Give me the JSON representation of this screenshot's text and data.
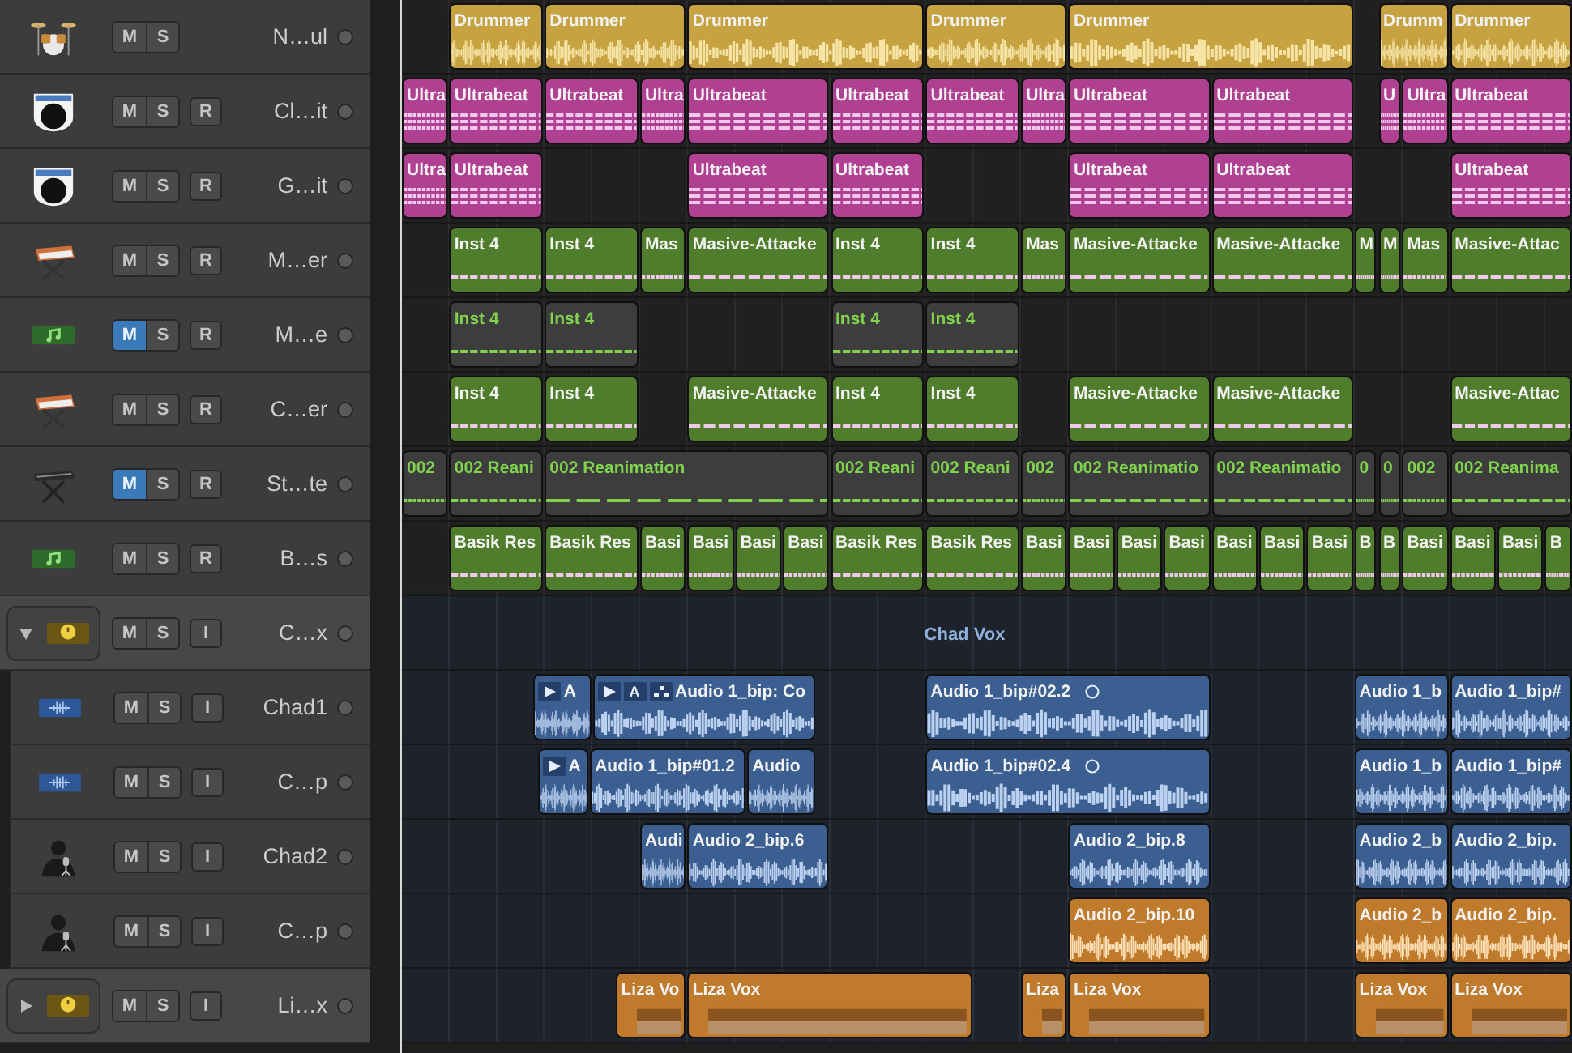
{
  "tracks": [
    {
      "name": "N…ul",
      "kind": "drummer",
      "color": "#c7a240",
      "buttons": [
        {
          "label": "M",
          "kind": "mute",
          "on": false
        },
        {
          "label": "S",
          "kind": "solo",
          "on": false
        }
      ],
      "regions": [
        {
          "name": "Drummer"
        },
        {
          "name": "Drummer"
        },
        {
          "name": "Drummer"
        },
        {
          "name": "Drummer"
        },
        {
          "name": "Drummer"
        },
        {
          "name": "Drumm"
        },
        {
          "name": "Drummer"
        }
      ]
    },
    {
      "name": "Cl…it",
      "kind": "drum-machine",
      "color": "#b04192",
      "buttons": [
        {
          "label": "M",
          "kind": "mute",
          "on": false
        },
        {
          "label": "S",
          "kind": "solo",
          "on": false
        },
        {
          "label": "R",
          "kind": "record",
          "on": false
        }
      ],
      "regions": [
        {
          "name": "Ultra"
        },
        {
          "name": "Ultrabeat"
        },
        {
          "name": "Ultrabeat"
        },
        {
          "name": "Ultra"
        },
        {
          "name": "Ultrabeat"
        },
        {
          "name": "Ultrabeat"
        },
        {
          "name": "Ultrabeat"
        },
        {
          "name": "Ultra"
        },
        {
          "name": "Ultrabeat"
        },
        {
          "name": "Ultrabeat"
        },
        {
          "name": "U"
        },
        {
          "name": "Ultra"
        },
        {
          "name": "Ultrabeat"
        }
      ]
    },
    {
      "name": "G…it",
      "kind": "drum-machine",
      "color": "#b04192",
      "buttons": [
        {
          "label": "M",
          "kind": "mute",
          "on": false
        },
        {
          "label": "S",
          "kind": "solo",
          "on": false
        },
        {
          "label": "R",
          "kind": "record",
          "on": false
        }
      ],
      "regions": [
        {
          "name": "Ultra"
        },
        {
          "name": "Ultrabeat"
        },
        {
          "name": "Ultrabeat"
        },
        {
          "name": "Ultrabeat"
        },
        {
          "name": "Ultrabeat"
        },
        {
          "name": "Ultrabeat"
        },
        {
          "name": "Ultrabeat"
        }
      ]
    },
    {
      "name": "M…er",
      "kind": "synth",
      "color": "#507d2b",
      "buttons": [
        {
          "label": "M",
          "kind": "mute",
          "on": false
        },
        {
          "label": "S",
          "kind": "solo",
          "on": false
        },
        {
          "label": "R",
          "kind": "record",
          "on": false
        }
      ],
      "regions": [
        {
          "name": "Inst 4"
        },
        {
          "name": "Inst 4"
        },
        {
          "name": "Mas"
        },
        {
          "name": "Masive-Attacke"
        },
        {
          "name": "Inst 4"
        },
        {
          "name": "Inst 4"
        },
        {
          "name": "Mas"
        },
        {
          "name": "Masive-Attacke"
        },
        {
          "name": "Masive-Attacke"
        },
        {
          "name": "M"
        },
        {
          "name": "M"
        },
        {
          "name": "Mas"
        },
        {
          "name": "Masive-Attac"
        }
      ]
    },
    {
      "name": "M…e",
      "kind": "midi",
      "color": "#7fd14e",
      "buttons": [
        {
          "label": "M",
          "kind": "mute",
          "on": true
        },
        {
          "label": "S",
          "kind": "solo",
          "on": false
        },
        {
          "label": "R",
          "kind": "record",
          "on": false
        }
      ],
      "regions": [
        {
          "name": "Inst 4"
        },
        {
          "name": "Inst 4"
        },
        {
          "name": "Inst 4"
        },
        {
          "name": "Inst 4"
        }
      ]
    },
    {
      "name": "C…er",
      "kind": "synth",
      "color": "#507d2b",
      "buttons": [
        {
          "label": "M",
          "kind": "mute",
          "on": false
        },
        {
          "label": "S",
          "kind": "solo",
          "on": false
        },
        {
          "label": "R",
          "kind": "record",
          "on": false
        }
      ],
      "regions": [
        {
          "name": "Inst 4"
        },
        {
          "name": "Inst 4"
        },
        {
          "name": "Masive-Attacke"
        },
        {
          "name": "Inst 4"
        },
        {
          "name": "Inst 4"
        },
        {
          "name": "Masive-Attacke"
        },
        {
          "name": "Masive-Attacke"
        },
        {
          "name": "Masive-Attac"
        }
      ]
    },
    {
      "name": "St…te",
      "kind": "keyboard",
      "color": "#7fd14e",
      "buttons": [
        {
          "label": "M",
          "kind": "mute",
          "on": true
        },
        {
          "label": "S",
          "kind": "solo",
          "on": false
        },
        {
          "label": "R",
          "kind": "record",
          "on": false
        }
      ],
      "regions": [
        {
          "name": "002"
        },
        {
          "name": "002 Reani"
        },
        {
          "name": "002 Reanimation"
        },
        {
          "name": "002 Reani"
        },
        {
          "name": "002 Reani"
        },
        {
          "name": "002"
        },
        {
          "name": "002 Reanimatio"
        },
        {
          "name": "002 Reanimatio"
        },
        {
          "name": "0"
        },
        {
          "name": "0"
        },
        {
          "name": "002"
        },
        {
          "name": "002 Reanima"
        }
      ]
    },
    {
      "name": "B…s",
      "kind": "midi",
      "color": "#507d2b",
      "buttons": [
        {
          "label": "M",
          "kind": "mute",
          "on": false
        },
        {
          "label": "S",
          "kind": "solo",
          "on": false
        },
        {
          "label": "R",
          "kind": "record",
          "on": false
        }
      ],
      "regions": [
        {
          "name": "Basik Res"
        },
        {
          "name": "Basik Res"
        },
        {
          "name": "Basi"
        },
        {
          "name": "Basi"
        },
        {
          "name": "Basi"
        },
        {
          "name": "Basi"
        },
        {
          "name": "Basik Res"
        },
        {
          "name": "Basik Res"
        },
        {
          "name": "Basi"
        },
        {
          "name": "Basi"
        },
        {
          "name": "Basi"
        },
        {
          "name": "Basi"
        },
        {
          "name": "Basi"
        },
        {
          "name": "Basi"
        },
        {
          "name": "Basi"
        },
        {
          "name": "B"
        },
        {
          "name": "B"
        },
        {
          "name": "Basi"
        },
        {
          "name": "Basi"
        },
        {
          "name": "Basi"
        },
        {
          "name": "B"
        }
      ]
    },
    {
      "name": "C…x",
      "kind": "folder",
      "expanded": true,
      "lane_label": "Chad Vox",
      "buttons": [
        {
          "label": "M",
          "kind": "mute",
          "on": false
        },
        {
          "label": "S",
          "kind": "solo",
          "on": false
        },
        {
          "label": "I",
          "kind": "input",
          "on": false
        }
      ],
      "children": [
        {
          "name": "Chad1",
          "kind": "audio",
          "color": "#3b5f90",
          "buttons": [
            {
              "label": "M",
              "kind": "mute",
              "on": false
            },
            {
              "label": "S",
              "kind": "solo",
              "on": false
            },
            {
              "label": "I",
              "kind": "input",
              "on": false
            }
          ],
          "regions": [
            {
              "name": "A",
              "take": true,
              "comp": false,
              "circle": false
            },
            {
              "name": "Audio 1_bip: Co",
              "badge": "A",
              "take": true,
              "comp": true,
              "circle": false
            },
            {
              "name": "Audio 1_bip#02.2",
              "take": false,
              "comp": false,
              "circle": true
            },
            {
              "name": "Audio 1_b",
              "take": false,
              "comp": false,
              "circle": false
            },
            {
              "name": "Audio 1_bip#",
              "take": false,
              "comp": false,
              "circle": false
            }
          ]
        },
        {
          "name": "C…p",
          "kind": "audio",
          "color": "#3b5f90",
          "buttons": [
            {
              "label": "M",
              "kind": "mute",
              "on": false
            },
            {
              "label": "S",
              "kind": "solo",
              "on": false
            },
            {
              "label": "I",
              "kind": "input",
              "on": false
            }
          ],
          "regions": [
            {
              "name": "A",
              "take": true,
              "comp": false,
              "circle": false
            },
            {
              "name": "Audio 1_bip#01.2",
              "take": false,
              "comp": false,
              "circle": false
            },
            {
              "name": "Audio",
              "take": false,
              "comp": false,
              "circle": false
            },
            {
              "name": "Audio 1_bip#02.4",
              "take": false,
              "comp": false,
              "circle": true
            },
            {
              "name": "Audio 1_b",
              "take": false,
              "comp": false,
              "circle": false
            },
            {
              "name": "Audio 1_bip#",
              "take": false,
              "comp": false,
              "circle": false
            }
          ]
        },
        {
          "name": "Chad2",
          "kind": "vocal",
          "color": "#3b5f90",
          "buttons": [
            {
              "label": "M",
              "kind": "mute",
              "on": false
            },
            {
              "label": "S",
              "kind": "solo",
              "on": false
            },
            {
              "label": "I",
              "kind": "input",
              "on": false
            }
          ],
          "regions": [
            {
              "name": "Audi",
              "take": false,
              "comp": false,
              "circle": false
            },
            {
              "name": "Audio 2_bip.6",
              "take": false,
              "comp": false,
              "circle": false
            },
            {
              "name": "Audio 2_bip.8",
              "take": false,
              "comp": false,
              "circle": false
            },
            {
              "name": "Audio 2_b",
              "take": false,
              "comp": false,
              "circle": false
            },
            {
              "name": "Audio 2_bip.",
              "take": false,
              "comp": false,
              "circle": false
            }
          ]
        },
        {
          "name": "C…p",
          "kind": "vocal",
          "color": "#c07a2c",
          "buttons": [
            {
              "label": "M",
              "kind": "mute",
              "on": false
            },
            {
              "label": "S",
              "kind": "solo",
              "on": false
            },
            {
              "label": "I",
              "kind": "input",
              "on": false
            }
          ],
          "regions": [
            {
              "name": "Audio 2_bip.10",
              "take": false,
              "comp": false,
              "circle": false
            },
            {
              "name": "Audio 2_b",
              "take": false,
              "comp": false,
              "circle": false
            },
            {
              "name": "Audio 2_bip.",
              "take": false,
              "comp": false,
              "circle": false
            }
          ]
        }
      ]
    },
    {
      "name": "Li…x",
      "kind": "folder",
      "color": "#c07a2c",
      "expanded": false,
      "buttons": [
        {
          "label": "M",
          "kind": "mute",
          "on": false
        },
        {
          "label": "S",
          "kind": "solo",
          "on": false
        },
        {
          "label": "I",
          "kind": "input",
          "on": false
        }
      ],
      "regions": [
        {
          "name": "Liza Vo"
        },
        {
          "name": "Liza Vox"
        },
        {
          "name": "Liza"
        },
        {
          "name": "Liza Vox"
        },
        {
          "name": "Liza Vox"
        },
        {
          "name": "Liza Vox"
        }
      ]
    }
  ]
}
